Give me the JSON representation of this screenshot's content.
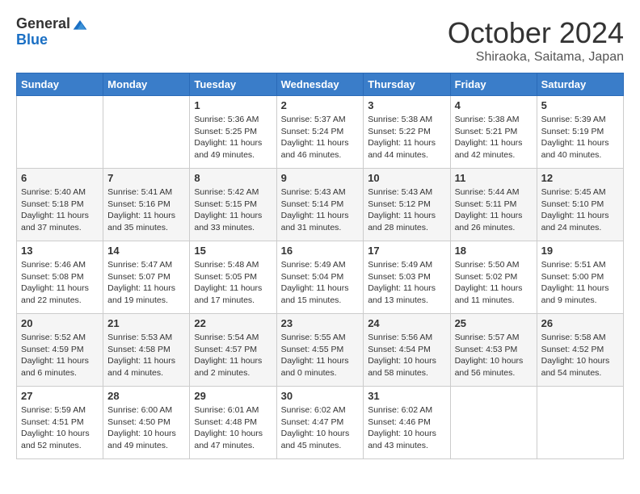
{
  "logo": {
    "general": "General",
    "blue": "Blue"
  },
  "header": {
    "month": "October 2024",
    "location": "Shiraoka, Saitama, Japan"
  },
  "weekdays": [
    "Sunday",
    "Monday",
    "Tuesday",
    "Wednesday",
    "Thursday",
    "Friday",
    "Saturday"
  ],
  "weeks": [
    [
      {
        "day": "",
        "info": ""
      },
      {
        "day": "",
        "info": ""
      },
      {
        "day": "1",
        "info": "Sunrise: 5:36 AM\nSunset: 5:25 PM\nDaylight: 11 hours and 49 minutes."
      },
      {
        "day": "2",
        "info": "Sunrise: 5:37 AM\nSunset: 5:24 PM\nDaylight: 11 hours and 46 minutes."
      },
      {
        "day": "3",
        "info": "Sunrise: 5:38 AM\nSunset: 5:22 PM\nDaylight: 11 hours and 44 minutes."
      },
      {
        "day": "4",
        "info": "Sunrise: 5:38 AM\nSunset: 5:21 PM\nDaylight: 11 hours and 42 minutes."
      },
      {
        "day": "5",
        "info": "Sunrise: 5:39 AM\nSunset: 5:19 PM\nDaylight: 11 hours and 40 minutes."
      }
    ],
    [
      {
        "day": "6",
        "info": "Sunrise: 5:40 AM\nSunset: 5:18 PM\nDaylight: 11 hours and 37 minutes."
      },
      {
        "day": "7",
        "info": "Sunrise: 5:41 AM\nSunset: 5:16 PM\nDaylight: 11 hours and 35 minutes."
      },
      {
        "day": "8",
        "info": "Sunrise: 5:42 AM\nSunset: 5:15 PM\nDaylight: 11 hours and 33 minutes."
      },
      {
        "day": "9",
        "info": "Sunrise: 5:43 AM\nSunset: 5:14 PM\nDaylight: 11 hours and 31 minutes."
      },
      {
        "day": "10",
        "info": "Sunrise: 5:43 AM\nSunset: 5:12 PM\nDaylight: 11 hours and 28 minutes."
      },
      {
        "day": "11",
        "info": "Sunrise: 5:44 AM\nSunset: 5:11 PM\nDaylight: 11 hours and 26 minutes."
      },
      {
        "day": "12",
        "info": "Sunrise: 5:45 AM\nSunset: 5:10 PM\nDaylight: 11 hours and 24 minutes."
      }
    ],
    [
      {
        "day": "13",
        "info": "Sunrise: 5:46 AM\nSunset: 5:08 PM\nDaylight: 11 hours and 22 minutes."
      },
      {
        "day": "14",
        "info": "Sunrise: 5:47 AM\nSunset: 5:07 PM\nDaylight: 11 hours and 19 minutes."
      },
      {
        "day": "15",
        "info": "Sunrise: 5:48 AM\nSunset: 5:05 PM\nDaylight: 11 hours and 17 minutes."
      },
      {
        "day": "16",
        "info": "Sunrise: 5:49 AM\nSunset: 5:04 PM\nDaylight: 11 hours and 15 minutes."
      },
      {
        "day": "17",
        "info": "Sunrise: 5:49 AM\nSunset: 5:03 PM\nDaylight: 11 hours and 13 minutes."
      },
      {
        "day": "18",
        "info": "Sunrise: 5:50 AM\nSunset: 5:02 PM\nDaylight: 11 hours and 11 minutes."
      },
      {
        "day": "19",
        "info": "Sunrise: 5:51 AM\nSunset: 5:00 PM\nDaylight: 11 hours and 9 minutes."
      }
    ],
    [
      {
        "day": "20",
        "info": "Sunrise: 5:52 AM\nSunset: 4:59 PM\nDaylight: 11 hours and 6 minutes."
      },
      {
        "day": "21",
        "info": "Sunrise: 5:53 AM\nSunset: 4:58 PM\nDaylight: 11 hours and 4 minutes."
      },
      {
        "day": "22",
        "info": "Sunrise: 5:54 AM\nSunset: 4:57 PM\nDaylight: 11 hours and 2 minutes."
      },
      {
        "day": "23",
        "info": "Sunrise: 5:55 AM\nSunset: 4:55 PM\nDaylight: 11 hours and 0 minutes."
      },
      {
        "day": "24",
        "info": "Sunrise: 5:56 AM\nSunset: 4:54 PM\nDaylight: 10 hours and 58 minutes."
      },
      {
        "day": "25",
        "info": "Sunrise: 5:57 AM\nSunset: 4:53 PM\nDaylight: 10 hours and 56 minutes."
      },
      {
        "day": "26",
        "info": "Sunrise: 5:58 AM\nSunset: 4:52 PM\nDaylight: 10 hours and 54 minutes."
      }
    ],
    [
      {
        "day": "27",
        "info": "Sunrise: 5:59 AM\nSunset: 4:51 PM\nDaylight: 10 hours and 52 minutes."
      },
      {
        "day": "28",
        "info": "Sunrise: 6:00 AM\nSunset: 4:50 PM\nDaylight: 10 hours and 49 minutes."
      },
      {
        "day": "29",
        "info": "Sunrise: 6:01 AM\nSunset: 4:48 PM\nDaylight: 10 hours and 47 minutes."
      },
      {
        "day": "30",
        "info": "Sunrise: 6:02 AM\nSunset: 4:47 PM\nDaylight: 10 hours and 45 minutes."
      },
      {
        "day": "31",
        "info": "Sunrise: 6:02 AM\nSunset: 4:46 PM\nDaylight: 10 hours and 43 minutes."
      },
      {
        "day": "",
        "info": ""
      },
      {
        "day": "",
        "info": ""
      }
    ]
  ]
}
